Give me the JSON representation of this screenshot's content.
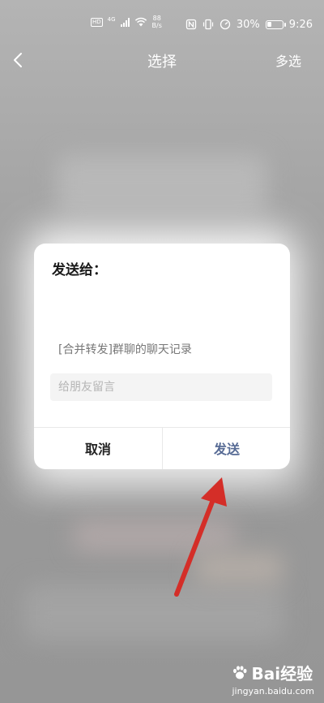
{
  "status_bar": {
    "hd_badge": "HD",
    "network_type": "4G",
    "speed_value": "88",
    "speed_unit": "B/s",
    "battery_percent": "30%",
    "battery_level": 0.3,
    "time": "9:26"
  },
  "nav": {
    "back_icon": "chevron-left-icon",
    "title": "选择",
    "multi_select_label": "多选"
  },
  "dialog": {
    "title": "发送给：",
    "forward_text": "[合并转发]群聊的聊天记录",
    "message_placeholder": "给朋友留言",
    "message_value": "",
    "cancel_label": "取消",
    "send_label": "发送",
    "send_color": "#576b95"
  },
  "annotation": {
    "arrow_color": "#d42e28"
  },
  "watermark": {
    "brand": "Bai经验",
    "url": "jingyan.baidu.com"
  }
}
